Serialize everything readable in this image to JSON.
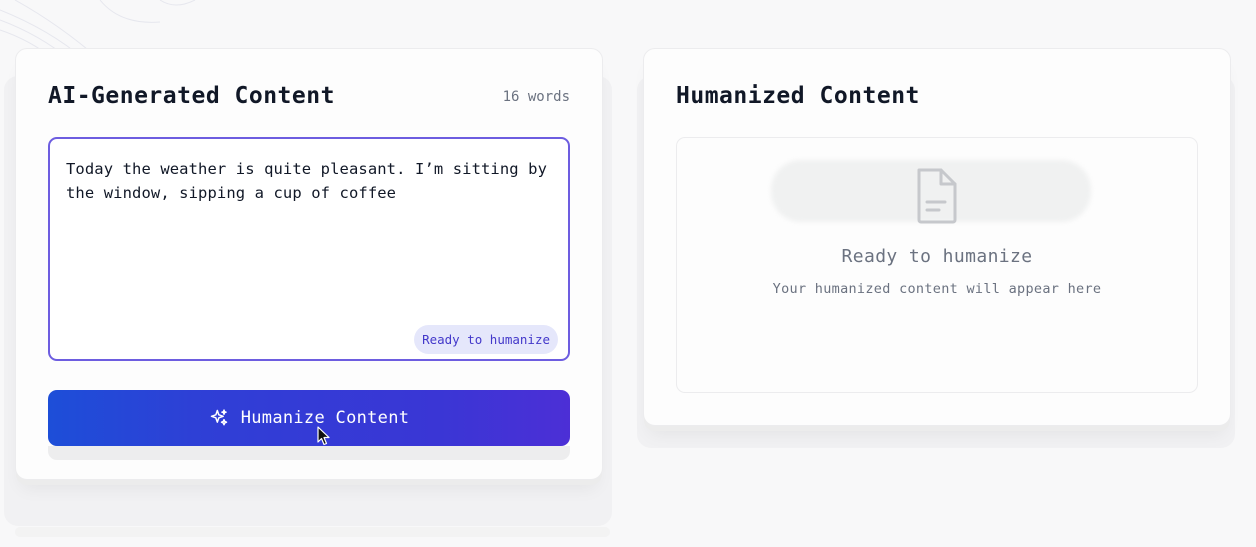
{
  "input_panel": {
    "title": "AI-Generated Content",
    "word_count": "16 words",
    "input_text": "Today the weather is quite pleasant. I’m sitting by the window, sipping a cup of coffee",
    "status": "Ready to humanize",
    "button_label": "Humanize Content",
    "button_icon": "sparkles-icon"
  },
  "output_panel": {
    "title": "Humanized Content",
    "empty_icon": "document-icon",
    "empty_title": "Ready to humanize",
    "empty_subtitle": "Your humanized content will appear here"
  },
  "colors": {
    "accent": "#6d5de0",
    "button_start": "#1d4ed8",
    "button_end": "#4c2fd6",
    "pill_bg": "#e5e7fb",
    "pill_text": "#4338ca"
  }
}
